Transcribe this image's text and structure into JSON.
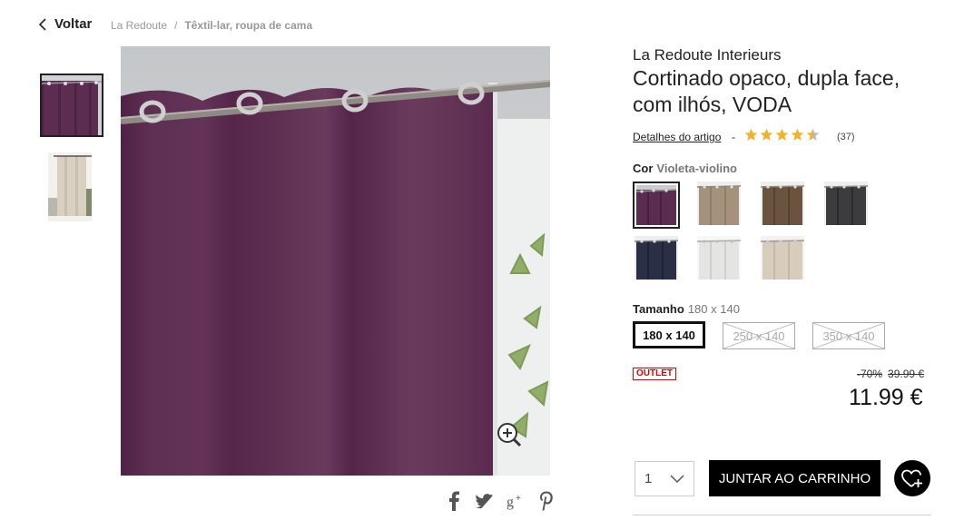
{
  "nav": {
    "back_label": "Voltar",
    "breadcrumb": [
      "La Redoute",
      "Têxtil-lar, roupa de cama"
    ]
  },
  "product": {
    "brand": "La Redoute Interieurs",
    "title": "Cortinado opaco, dupla face, com ilhós, VODA",
    "details_link": "Detalhes do artigo",
    "rating_stars": 4.5,
    "review_count": "(37)",
    "color_label": "Cor",
    "color_value": "Violeta-violino",
    "swatches": [
      {
        "name": "Violeta-violino",
        "color": "#5a2c4f",
        "selected": true
      },
      {
        "name": "Taupe",
        "color": "#a5927c"
      },
      {
        "name": "Castanho",
        "color": "#6a5440"
      },
      {
        "name": "Cinzento-antracite",
        "color": "#3c3c3f"
      },
      {
        "name": "Azul-marinho",
        "color": "#2a2f45"
      },
      {
        "name": "Branco",
        "color": "#e4e4e2"
      },
      {
        "name": "Cru",
        "color": "#d8cdbd"
      }
    ],
    "size_label": "Tamanho",
    "size_value": "180 x 140",
    "sizes": [
      {
        "label": "180 x 140",
        "available": true
      },
      {
        "label": "250 x 140",
        "available": false
      },
      {
        "label": "350 x 140",
        "available": false
      }
    ],
    "outlet_badge": "OUTLET",
    "discount": "-70%",
    "old_price": "39.99 €",
    "price": "11.99 €",
    "quantity": "1",
    "cart_label": "JUNTAR AO CARRINHO"
  },
  "colors": {
    "curtain": "#5c2d51",
    "wall": "#cfd3d5",
    "accent_red": "#dd0000"
  }
}
